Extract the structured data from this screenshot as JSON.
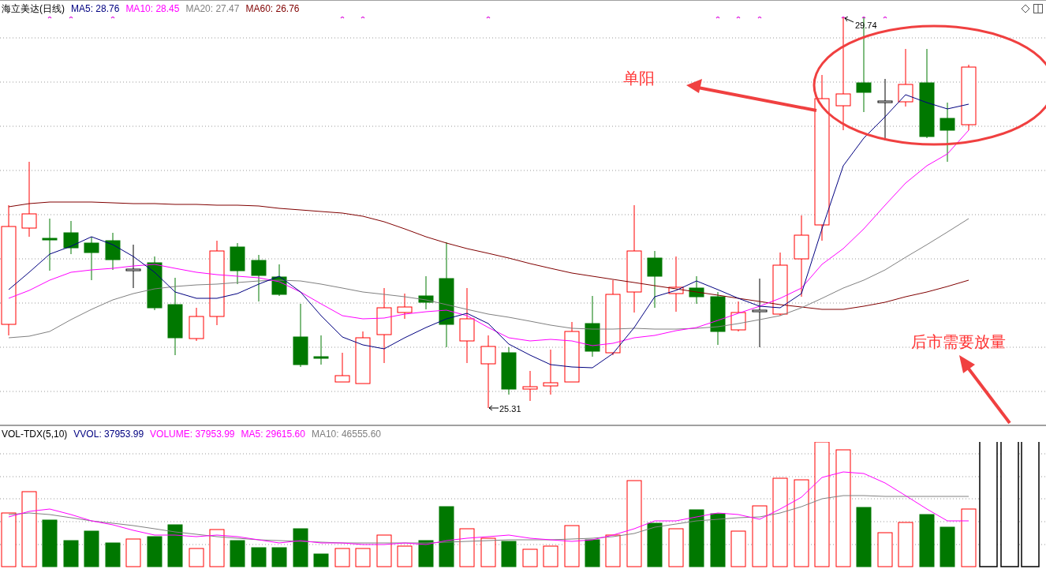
{
  "price_panel": {
    "title": "海立美达(日线)",
    "indicators": [
      {
        "label": "MA5: 28.76",
        "color": "#000080"
      },
      {
        "label": "MA10: 28.45",
        "color": "#ff00ff"
      },
      {
        "label": "MA20: 27.47",
        "color": "#808080"
      },
      {
        "label": "MA60: 26.76",
        "color": "#800000"
      }
    ],
    "high_label": "29.74",
    "low_label": "25.31",
    "annotations": [
      {
        "kind": "arrow-left",
        "text": "单阳"
      },
      {
        "kind": "arrow-up",
        "text": "后市需要放量"
      }
    ]
  },
  "volume_panel": {
    "title": "VOL-TDX(5,10)",
    "indicators": [
      {
        "label": "VVOL: 37953.99",
        "color": "#000080"
      },
      {
        "label": "VOLUME: 37953.99",
        "color": "#ff00ff"
      },
      {
        "label": "MA5: 29615.60",
        "color": "#ff00ff"
      },
      {
        "label": "MA10: 46555.60",
        "color": "#808080"
      }
    ]
  }
}
